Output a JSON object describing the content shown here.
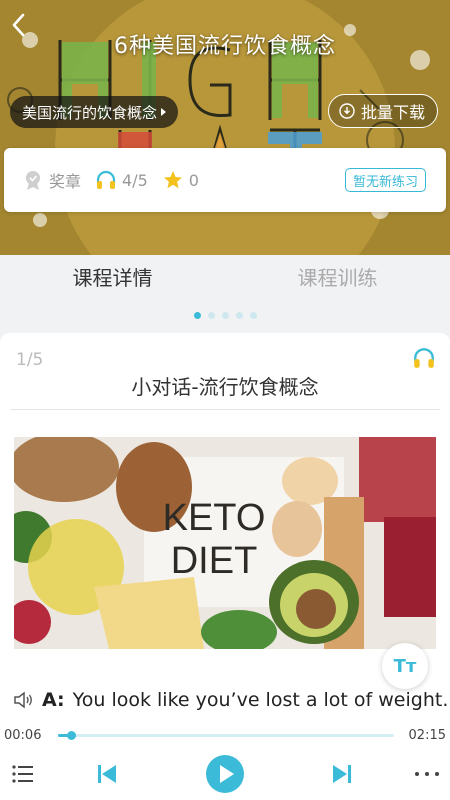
{
  "header": {
    "title": "6种美国流行饮食概念",
    "course_pill": "美国流行的饮食概念",
    "download_label": "批量下载",
    "banner_colors": {
      "base": "#9c7f2a",
      "accent": "#38b9d6"
    }
  },
  "stats": {
    "medal_label": "奖章",
    "listen_progress": "4/5",
    "stars": "0",
    "practice_badge": "暂无新练习"
  },
  "tabs": [
    {
      "label": "课程详情",
      "active": true
    },
    {
      "label": "课程训练",
      "active": false
    }
  ],
  "pager_dots": {
    "count": 5,
    "active_index": 0
  },
  "dialog": {
    "pager": "1/5",
    "title": "小对话-流行饮食概念",
    "image_text_line1": "KETO",
    "image_text_line2": "DIET",
    "text_size_icon": "Tт",
    "speaker": "A:",
    "sentence": "You look like you’ve lost a lot of weight."
  },
  "player": {
    "elapsed": "00:06",
    "total": "02:15",
    "progress_fraction": 0.04
  },
  "icons": [
    "back-icon",
    "download-icon",
    "medal-icon",
    "headphones-icon",
    "star-icon",
    "speaker-icon",
    "text-size-icon",
    "list-icon",
    "prev-icon",
    "play-icon",
    "next-icon",
    "more-icon"
  ]
}
